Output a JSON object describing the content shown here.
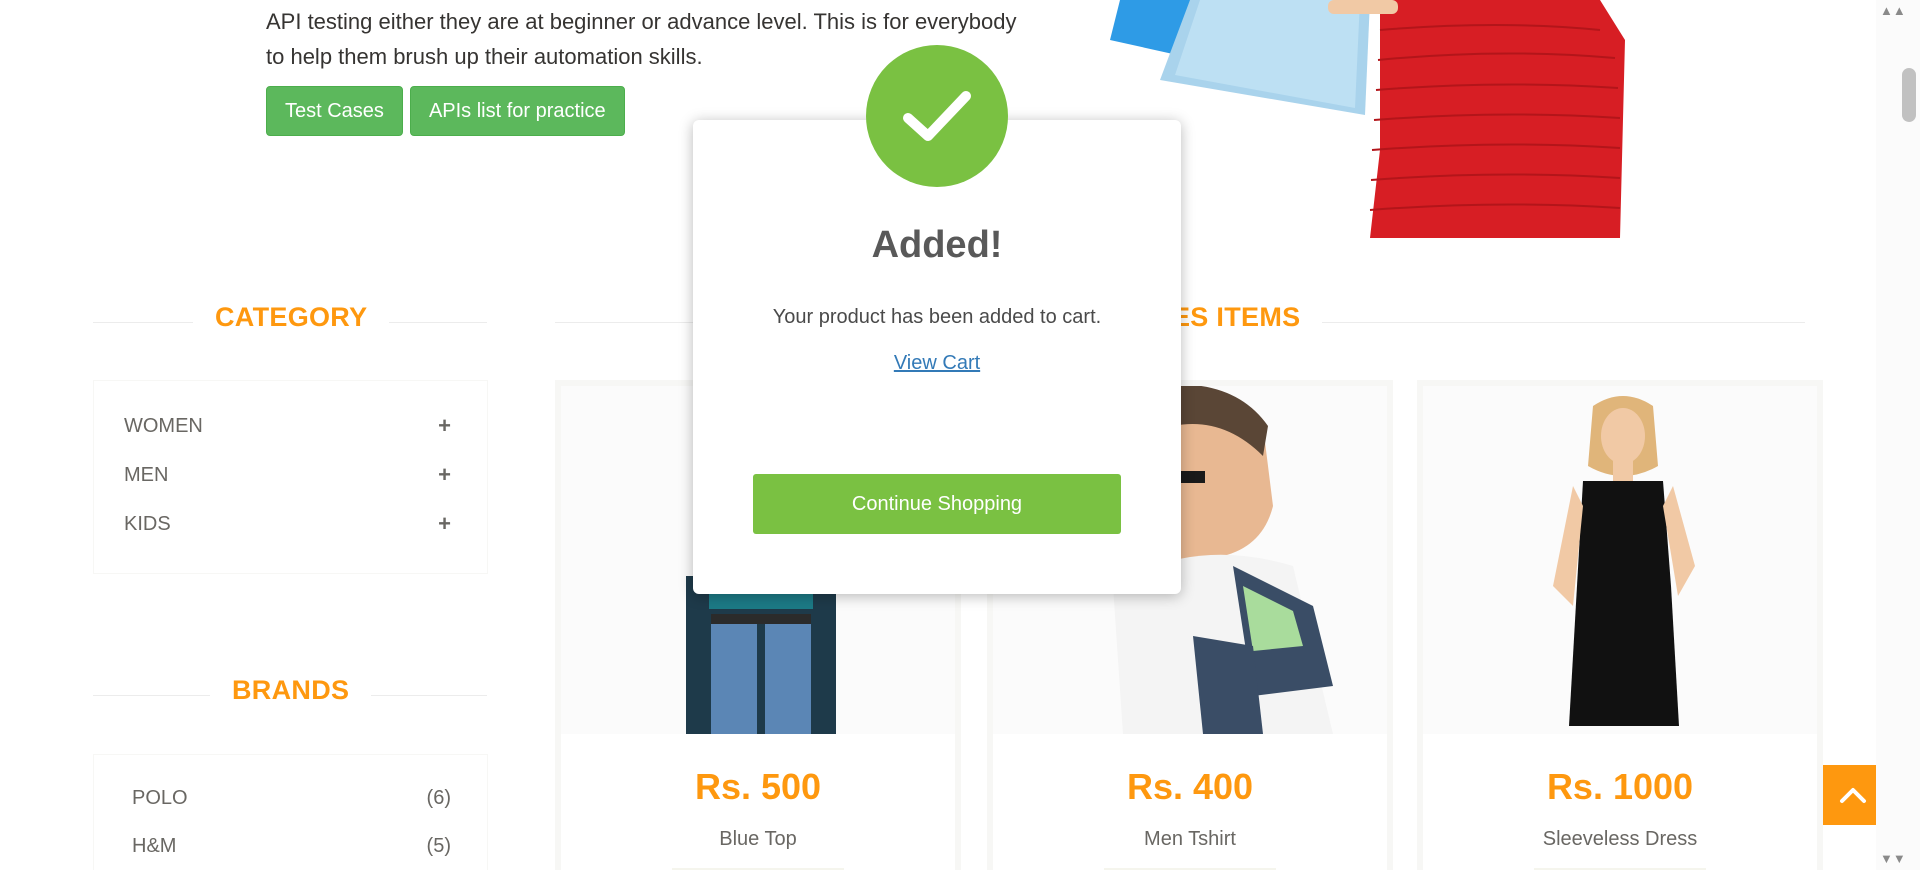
{
  "hero": {
    "text": "API testing either they are at beginner or advance level. This is for everybody to help them brush up their automation skills.",
    "buttons": [
      "Test Cases",
      "APIs list for practice"
    ]
  },
  "category": {
    "title": "CATEGORY",
    "items": [
      {
        "label": "WOMEN",
        "icon": "plus-icon"
      },
      {
        "label": "MEN",
        "icon": "plus-icon"
      },
      {
        "label": "KIDS",
        "icon": "plus-icon"
      }
    ]
  },
  "features": {
    "title_visible": "ES ITEMS"
  },
  "brands": {
    "title": "BRANDS",
    "items": [
      {
        "name": "POLO",
        "count": "(6)"
      },
      {
        "name": "H&M",
        "count": "(5)"
      }
    ]
  },
  "products": [
    {
      "price": "Rs. 500",
      "name": "Blue Top"
    },
    {
      "price": "Rs. 400",
      "name": "Men Tshirt"
    },
    {
      "price": "Rs. 1000",
      "name": "Sleeveless Dress"
    }
  ],
  "modal": {
    "title": "Added!",
    "message": "Your product has been added to cart.",
    "link": "View Cart",
    "button": "Continue Shopping",
    "icon": "checkmark-icon"
  },
  "colors": {
    "accent_orange": "#fe980f",
    "success_green": "#7ac142",
    "button_green": "#5cb85c",
    "link_blue": "#337ab7"
  }
}
